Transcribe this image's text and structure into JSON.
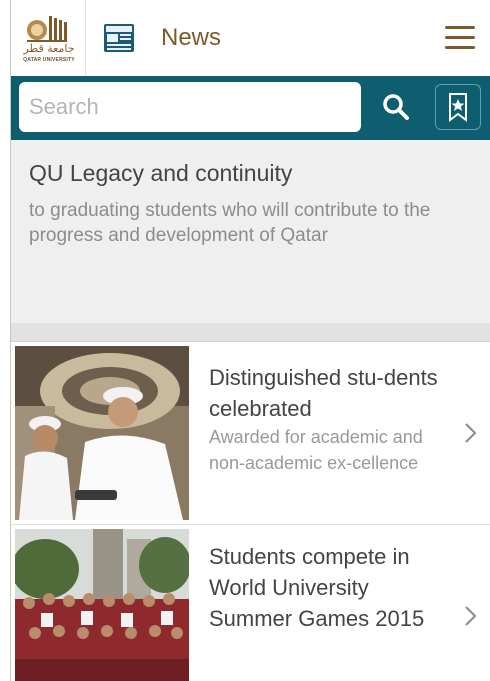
{
  "header": {
    "logo": {
      "arabic": "جامعة قطر",
      "english": "QATAR UNIVERSITY"
    },
    "title": "News",
    "icons": {
      "news": "newspaper-icon",
      "menu": "hamburger-menu-icon"
    }
  },
  "search": {
    "placeholder": "Search",
    "value": "",
    "icons": {
      "search": "search-icon",
      "bookmark": "bookmark-star-icon"
    }
  },
  "feature": {
    "title": "QU Legacy and continuity",
    "subtitle": "to graduating students who will contribute to the progress and development of Qatar"
  },
  "news_items": [
    {
      "title": "Distinguished stu-dents celebrated",
      "subtitle": "Awarded for academic and non-academic ex-cellence"
    },
    {
      "title": "Students compete in World University Summer Games 2015",
      "subtitle": ""
    }
  ],
  "colors": {
    "brand_brown": "#7d5a2c",
    "teal_bar": "#0e5e6f",
    "feature_bg": "#efefef"
  }
}
